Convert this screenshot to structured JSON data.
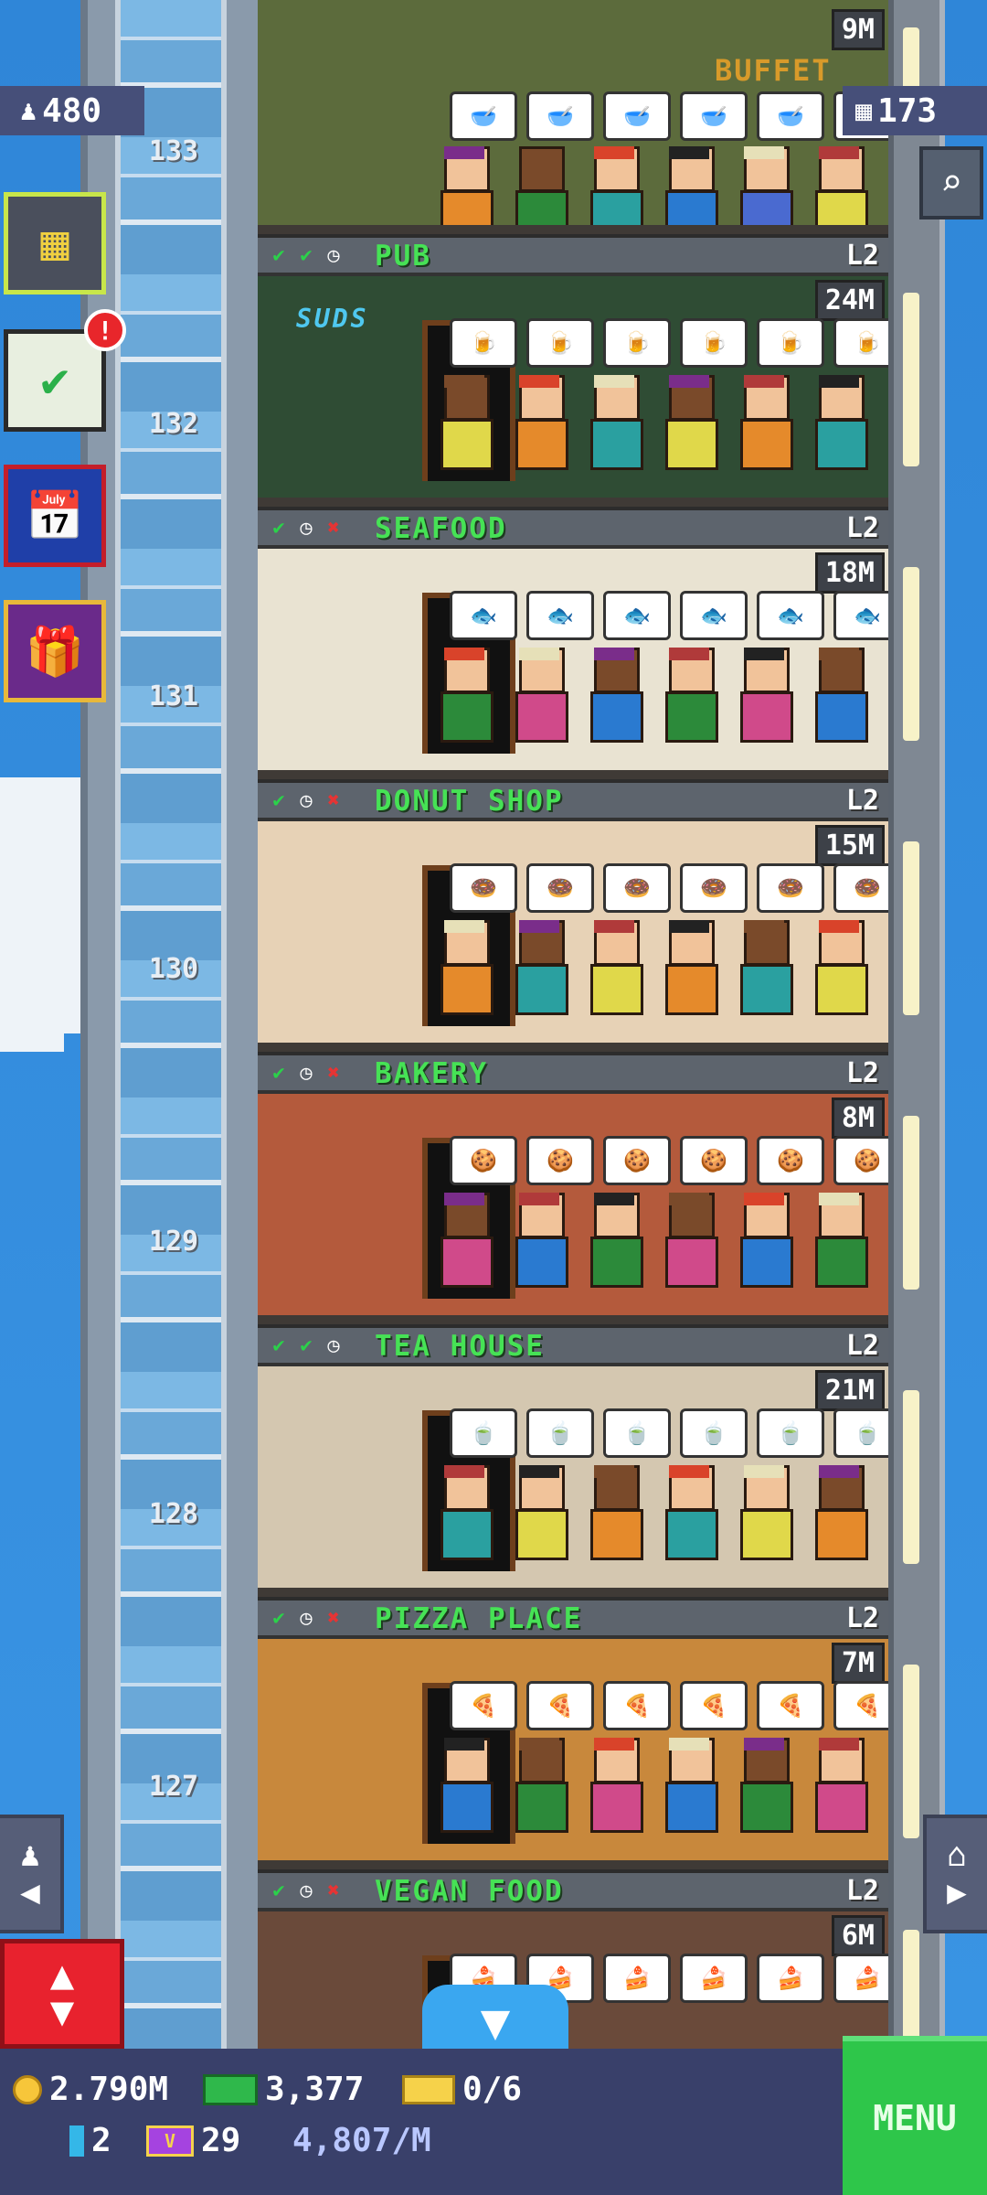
{
  "hud": {
    "population": "480",
    "stories": "173"
  },
  "floors": [
    {
      "name": "",
      "level": "",
      "value": "9M",
      "top_sign": "BUFFET",
      "bg": "#5c6b3c",
      "bubble": "🥣"
    },
    {
      "name": "PUB",
      "level": "L2",
      "value": "24M",
      "sign": "SUDS",
      "floor_number": "132",
      "bg": "#2f4c34",
      "bubble": "🍺"
    },
    {
      "name": "SEAFOOD",
      "level": "L2",
      "value": "18M",
      "floor_number": "131",
      "bg": "#e9e3d2",
      "bubble": "🐟"
    },
    {
      "name": "DONUT SHOP",
      "level": "L2",
      "value": "15M",
      "floor_number": "130",
      "bg": "#e7d2b6",
      "bubble": "🍩"
    },
    {
      "name": "BAKERY",
      "level": "L2",
      "value": "8M",
      "floor_number": "129",
      "bg": "#b45a3c",
      "bubble": "🍪"
    },
    {
      "name": "TEA HOUSE",
      "level": "L2",
      "value": "21M",
      "floor_number": "128",
      "bg": "#d4c7b0",
      "bubble": "🍵"
    },
    {
      "name": "PIZZA PLACE",
      "level": "L2",
      "value": "7M",
      "floor_number": "127",
      "bg": "#c8883c",
      "bubble": "🍕"
    },
    {
      "name": "VEGAN FOOD",
      "level": "L2",
      "value": "6M",
      "bg": "#6a4a3a",
      "bubble": "🍰"
    }
  ],
  "top_floor_number": "133",
  "bottom": {
    "coins": "2.790M",
    "bux": "3,377",
    "tickets": "0/6",
    "keys": "2",
    "vip": "29",
    "rate": "4,807/M",
    "menu": "MENU"
  },
  "badge": "!",
  "colors": {
    "menu": "#2ec64a",
    "name_green": "#46e255",
    "elevator_red": "#e8222e"
  }
}
